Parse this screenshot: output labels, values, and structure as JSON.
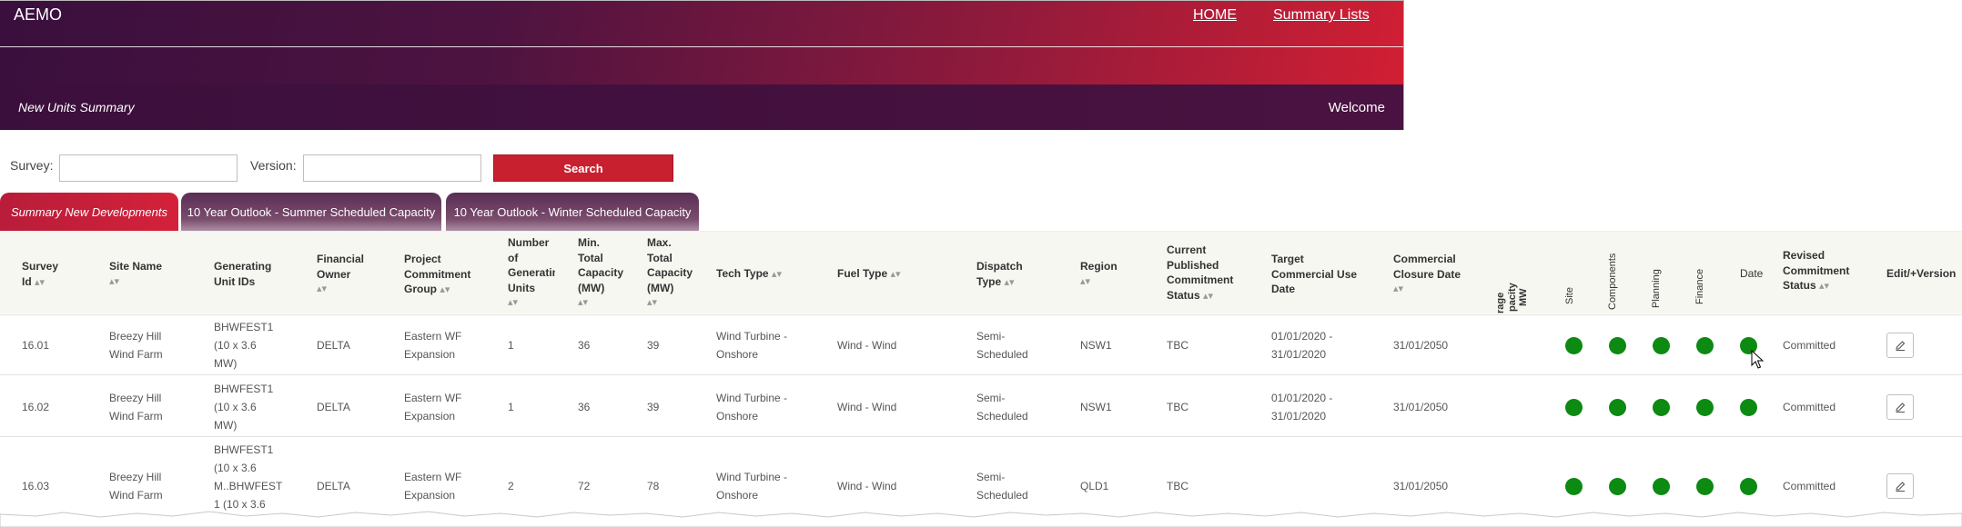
{
  "header": {
    "brand": "AEMO",
    "nav": [
      "HOME",
      "Summary Lists"
    ],
    "page_title": "New Units Summary",
    "welcome": "Welcome"
  },
  "search": {
    "survey_label": "Survey:",
    "survey_value": "",
    "version_label": "Version:",
    "version_value": "",
    "button": "Search"
  },
  "tabs": [
    {
      "label": "Summary New Developments",
      "active": true
    },
    {
      "label": "10 Year Outlook - Summer Scheduled Capacity",
      "active": false
    },
    {
      "label": "10 Year Outlook - Winter Scheduled Capacity",
      "active": false
    }
  ],
  "columns": {
    "survey_id": [
      "Survey",
      "Id"
    ],
    "site_name": [
      "Site Name"
    ],
    "generating_unit_ids": [
      "Generating",
      "Unit IDs"
    ],
    "financial_owner": [
      "Financial",
      "Owner"
    ],
    "project_commitment_group": [
      "Project",
      "Commitment",
      "Group"
    ],
    "number_of_units": [
      "Number",
      "of",
      "Generating",
      "Units"
    ],
    "min_capacity": [
      "Min.",
      "Total",
      "Capacity",
      "(MW)"
    ],
    "max_capacity": [
      "Max.",
      "Total",
      "Capacity",
      "(MW)"
    ],
    "tech_type": [
      "Tech Type"
    ],
    "fuel_type": [
      "Fuel Type"
    ],
    "dispatch_type": [
      "Dispatch",
      "Type"
    ],
    "region": [
      "Region"
    ],
    "current_status": [
      "Current",
      "Published",
      "Commitment",
      "Status"
    ],
    "target_date": [
      "Target",
      "Commercial Use",
      "Date"
    ],
    "closure_date": [
      "Commercial",
      "Closure Date"
    ],
    "storage_capacity_partial": [
      "rage",
      "pacity",
      "MW"
    ],
    "criteria": [
      "Site",
      "Components",
      "Planning",
      "Finance",
      "Date"
    ],
    "revised_status": [
      "Revised",
      "Commitment",
      "Status"
    ],
    "edit": [
      "Edit/+Version"
    ]
  },
  "rows": [
    {
      "survey_id": "16.01",
      "site_name": [
        "Breezy Hill",
        "Wind Farm"
      ],
      "unit_ids": [
        "BHWFEST1",
        "(10 x 3.6",
        "MW)"
      ],
      "owner": "DELTA",
      "group": [
        "Eastern WF",
        "Expansion"
      ],
      "units": "1",
      "min": "36",
      "max": "39",
      "tech": [
        "Wind Turbine -",
        "Onshore"
      ],
      "fuel": "Wind - Wind",
      "dispatch": [
        "Semi-",
        "Scheduled"
      ],
      "region": "NSW1",
      "current": "TBC",
      "target": [
        "01/01/2020 -",
        "31/01/2020"
      ],
      "closure": "31/01/2050",
      "criteria_color": "#0c8a12",
      "revised": "Committed"
    },
    {
      "survey_id": "16.02",
      "site_name": [
        "Breezy Hill",
        "Wind Farm"
      ],
      "unit_ids": [
        "BHWFEST1",
        "(10 x 3.6",
        "MW)"
      ],
      "owner": "DELTA",
      "group": [
        "Eastern WF",
        "Expansion"
      ],
      "units": "1",
      "min": "36",
      "max": "39",
      "tech": [
        "Wind Turbine -",
        "Onshore"
      ],
      "fuel": "Wind - Wind",
      "dispatch": [
        "Semi-",
        "Scheduled"
      ],
      "region": "NSW1",
      "current": "TBC",
      "target": [
        "01/01/2020 -",
        "31/01/2020"
      ],
      "closure": "31/01/2050",
      "criteria_color": "#0c8a12",
      "revised": "Committed"
    },
    {
      "survey_id": "16.03",
      "site_name": [
        "Breezy Hill",
        "Wind Farm"
      ],
      "unit_ids": [
        "BHWFEST1",
        "(10 x 3.6",
        "M..BHWFEST",
        "1 (10 x 3.6"
      ],
      "owner": "DELTA",
      "group": [
        "Eastern WF",
        "Expansion"
      ],
      "units": "2",
      "min": "72",
      "max": "78",
      "tech": [
        "Wind Turbine -",
        "Onshore"
      ],
      "fuel": "Wind - Wind",
      "dispatch": [
        "Semi-",
        "Scheduled"
      ],
      "region": "QLD1",
      "current": "TBC",
      "target": [],
      "closure": "31/01/2050",
      "criteria_color": "#0c8a12",
      "revised": "Committed"
    }
  ],
  "icons": {
    "edit": "pencil-icon",
    "sort": "sort-arrows-icon",
    "cursor": "mouse-pointer-icon"
  }
}
